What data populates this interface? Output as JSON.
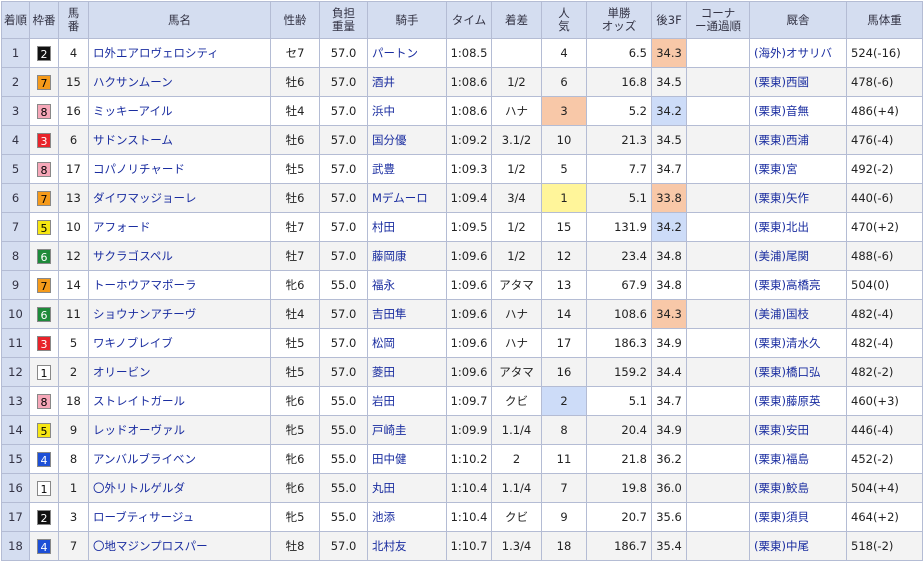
{
  "headers": {
    "rank": "着順",
    "waku": "枠番",
    "umaban": "馬番",
    "name": "馬名",
    "sexage": "性齢",
    "weight": "負担重量",
    "jockey": "騎手",
    "time": "タイム",
    "margin": "着差",
    "pop": "人気",
    "odds": "単勝オッズ",
    "last3f": "後3F",
    "corner": "コーナー通過順",
    "trainer": "厩舎",
    "body": "馬体重"
  },
  "waku_colors": {
    "1": {
      "bg": "#ffffff",
      "fg": "#000000"
    },
    "2": {
      "bg": "#111111",
      "fg": "#ffffff"
    },
    "3": {
      "bg": "#e8232a",
      "fg": "#ffffff"
    },
    "4": {
      "bg": "#1d4fd6",
      "fg": "#ffffff"
    },
    "5": {
      "bg": "#f6e612",
      "fg": "#000000"
    },
    "6": {
      "bg": "#1e8a3a",
      "fg": "#ffffff"
    },
    "7": {
      "bg": "#f59a1a",
      "fg": "#000000"
    },
    "8": {
      "bg": "#f6a7b8",
      "fg": "#000000"
    }
  },
  "rows": [
    {
      "rank": "1",
      "waku": "2",
      "umaban": "4",
      "name": "ロ外エアロヴェロシティ",
      "sexage": "セ7",
      "weight": "57.0",
      "jockey": "パートン",
      "time": "1:08.5",
      "margin": "",
      "pop": "4",
      "odds": "6.5",
      "last3f": "34.3",
      "f3rank": 1,
      "corner": "",
      "trainer": "(海外)オサリバ",
      "body": "524(-16)"
    },
    {
      "rank": "2",
      "waku": "7",
      "umaban": "15",
      "name": "ハクサンムーン",
      "sexage": "牡6",
      "weight": "57.0",
      "jockey": "酒井",
      "time": "1:08.6",
      "margin": "1/2",
      "pop": "6",
      "odds": "16.8",
      "last3f": "34.5",
      "f3rank": 0,
      "corner": "",
      "trainer": "(栗東)西園",
      "body": "478(-6)"
    },
    {
      "rank": "3",
      "waku": "8",
      "umaban": "16",
      "name": "ミッキーアイル",
      "sexage": "牡4",
      "weight": "57.0",
      "jockey": "浜中",
      "time": "1:08.6",
      "margin": "ハナ",
      "pop": "3",
      "odds": "5.2",
      "last3f": "34.2",
      "f3rank": 2,
      "corner": "",
      "trainer": "(栗東)音無",
      "body": "486(+4)"
    },
    {
      "rank": "4",
      "waku": "3",
      "umaban": "6",
      "name": "サドンストーム",
      "sexage": "牡6",
      "weight": "57.0",
      "jockey": "国分優",
      "time": "1:09.2",
      "margin": "3.1/2",
      "pop": "10",
      "odds": "21.3",
      "last3f": "34.5",
      "f3rank": 0,
      "corner": "",
      "trainer": "(栗東)西浦",
      "body": "476(-4)"
    },
    {
      "rank": "5",
      "waku": "8",
      "umaban": "17",
      "name": "コパノリチャード",
      "sexage": "牡5",
      "weight": "57.0",
      "jockey": "武豊",
      "time": "1:09.3",
      "margin": "1/2",
      "pop": "5",
      "odds": "7.7",
      "last3f": "34.7",
      "f3rank": 0,
      "corner": "",
      "trainer": "(栗東)宮",
      "body": "492(-2)"
    },
    {
      "rank": "6",
      "waku": "7",
      "umaban": "13",
      "name": "ダイワマッジョーレ",
      "sexage": "牡6",
      "weight": "57.0",
      "jockey": "Mデムーロ",
      "time": "1:09.4",
      "margin": "3/4",
      "pop": "1",
      "odds": "5.1",
      "last3f": "33.8",
      "f3rank": 1,
      "corner": "",
      "trainer": "(栗東)矢作",
      "body": "440(-6)"
    },
    {
      "rank": "7",
      "waku": "5",
      "umaban": "10",
      "name": "アフォード",
      "sexage": "牡7",
      "weight": "57.0",
      "jockey": "村田",
      "time": "1:09.5",
      "margin": "1/2",
      "pop": "15",
      "odds": "131.9",
      "last3f": "34.2",
      "f3rank": 2,
      "corner": "",
      "trainer": "(栗東)北出",
      "body": "470(+2)"
    },
    {
      "rank": "8",
      "waku": "6",
      "umaban": "12",
      "name": "サクラゴスペル",
      "sexage": "牡7",
      "weight": "57.0",
      "jockey": "藤岡康",
      "time": "1:09.6",
      "margin": "1/2",
      "pop": "12",
      "odds": "23.4",
      "last3f": "34.8",
      "f3rank": 0,
      "corner": "",
      "trainer": "(美浦)尾関",
      "body": "488(-6)"
    },
    {
      "rank": "9",
      "waku": "7",
      "umaban": "14",
      "name": "トーホウアマポーラ",
      "sexage": "牝6",
      "weight": "55.0",
      "jockey": "福永",
      "time": "1:09.6",
      "margin": "アタマ",
      "pop": "13",
      "odds": "67.9",
      "last3f": "34.8",
      "f3rank": 0,
      "corner": "",
      "trainer": "(栗東)高橋亮",
      "body": "504(0)"
    },
    {
      "rank": "10",
      "waku": "6",
      "umaban": "11",
      "name": "ショウナンアチーヴ",
      "sexage": "牡4",
      "weight": "57.0",
      "jockey": "吉田隼",
      "time": "1:09.6",
      "margin": "ハナ",
      "pop": "14",
      "odds": "108.6",
      "last3f": "34.3",
      "f3rank": 1,
      "corner": "",
      "trainer": "(美浦)国枝",
      "body": "482(-4)"
    },
    {
      "rank": "11",
      "waku": "3",
      "umaban": "5",
      "name": "ワキノブレイブ",
      "sexage": "牡5",
      "weight": "57.0",
      "jockey": "松岡",
      "time": "1:09.6",
      "margin": "ハナ",
      "pop": "17",
      "odds": "186.3",
      "last3f": "34.9",
      "f3rank": 0,
      "corner": "",
      "trainer": "(栗東)清水久",
      "body": "482(-4)"
    },
    {
      "rank": "12",
      "waku": "1",
      "umaban": "2",
      "name": "オリービン",
      "sexage": "牡5",
      "weight": "57.0",
      "jockey": "菱田",
      "time": "1:09.6",
      "margin": "アタマ",
      "pop": "16",
      "odds": "159.2",
      "last3f": "34.4",
      "f3rank": 0,
      "corner": "",
      "trainer": "(栗東)橋口弘",
      "body": "482(-2)"
    },
    {
      "rank": "13",
      "waku": "8",
      "umaban": "18",
      "name": "ストレイトガール",
      "sexage": "牝6",
      "weight": "55.0",
      "jockey": "岩田",
      "time": "1:09.7",
      "margin": "クビ",
      "pop": "2",
      "odds": "5.1",
      "last3f": "34.7",
      "f3rank": 0,
      "corner": "",
      "trainer": "(栗東)藤原英",
      "body": "460(+3)"
    },
    {
      "rank": "14",
      "waku": "5",
      "umaban": "9",
      "name": "レッドオーヴァル",
      "sexage": "牝5",
      "weight": "55.0",
      "jockey": "戸崎圭",
      "time": "1:09.9",
      "margin": "1.1/4",
      "pop": "8",
      "odds": "20.4",
      "last3f": "34.9",
      "f3rank": 0,
      "corner": "",
      "trainer": "(栗東)安田",
      "body": "446(-4)"
    },
    {
      "rank": "15",
      "waku": "4",
      "umaban": "8",
      "name": "アンバルブライベン",
      "sexage": "牝6",
      "weight": "55.0",
      "jockey": "田中健",
      "time": "1:10.2",
      "margin": "2",
      "pop": "11",
      "odds": "21.8",
      "last3f": "36.2",
      "f3rank": 0,
      "corner": "",
      "trainer": "(栗東)福島",
      "body": "452(-2)"
    },
    {
      "rank": "16",
      "waku": "1",
      "umaban": "1",
      "name": "〇外リトルゲルダ",
      "sexage": "牝6",
      "weight": "55.0",
      "jockey": "丸田",
      "time": "1:10.4",
      "margin": "1.1/4",
      "pop": "7",
      "odds": "19.8",
      "last3f": "36.0",
      "f3rank": 0,
      "corner": "",
      "trainer": "(栗東)鮫島",
      "body": "504(+4)"
    },
    {
      "rank": "17",
      "waku": "2",
      "umaban": "3",
      "name": "ローブティサージュ",
      "sexage": "牝5",
      "weight": "55.0",
      "jockey": "池添",
      "time": "1:10.4",
      "margin": "クビ",
      "pop": "9",
      "odds": "20.7",
      "last3f": "35.6",
      "f3rank": 0,
      "corner": "",
      "trainer": "(栗東)須貝",
      "body": "464(+2)"
    },
    {
      "rank": "18",
      "waku": "4",
      "umaban": "7",
      "name": "〇地マジンプロスパー",
      "sexage": "牡8",
      "weight": "57.0",
      "jockey": "北村友",
      "time": "1:10.7",
      "margin": "1.3/4",
      "pop": "18",
      "odds": "186.7",
      "last3f": "35.4",
      "f3rank": 0,
      "corner": "",
      "trainer": "(栗東)中尾",
      "body": "518(-2)"
    }
  ]
}
